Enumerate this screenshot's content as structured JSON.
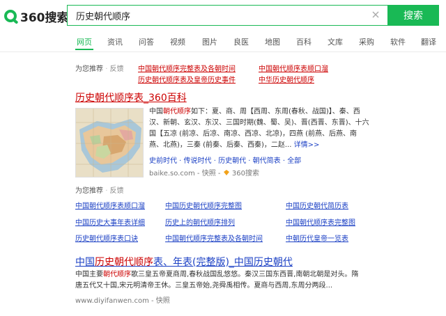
{
  "header": {
    "logo_text": "360搜索",
    "search_value": "历史朝代顺序",
    "search_button": "搜索"
  },
  "tabs": [
    "网页",
    "资讯",
    "问答",
    "视频",
    "图片",
    "良医",
    "地图",
    "百科",
    "文库",
    "采购",
    "软件",
    "翻译"
  ],
  "recommend_top": {
    "label": "为您推荐",
    "feedback": "反馈",
    "links": [
      "中国朝代顺序完整表及各朝时间",
      "中国朝代顺序表顺口溜",
      "历史朝代顺序表及皇帝历史事件",
      "中华历史朝代顺序"
    ]
  },
  "result1": {
    "title_prefix": "历史朝代顺序表",
    "title_suffix": "_360百科",
    "snippet_lines": [
      [
        "中国",
        "朝代顺序",
        "如下：夏、商、周【西周、东周(春秋、战国)】、秦、西"
      ],
      [
        "汉、新朝、玄汉、东汉、三国时期(魏、蜀、吴)、晋(西晋、东晋)、十六"
      ],
      [
        "国【五凉 (前凉、后凉、南凉、西凉、北凉)，四燕 (前燕、后燕、南"
      ],
      [
        "燕、北燕)，三秦 (前秦、后秦、西秦)，二赵...",
        "详情>>"
      ]
    ],
    "sub_links": [
      "史前时代",
      "传说时代",
      "历史朝代",
      "朝代简表",
      "全部"
    ],
    "url": "baike.so.com",
    "snapshot": "快照",
    "badge": "360搜索"
  },
  "recommend_mid": {
    "label": "为您推荐",
    "feedback": "反馈",
    "links": [
      [
        "中国朝代顺序表顺口溜",
        "中国历史朝代顺序完整图",
        "中国历史朝代简历表"
      ],
      [
        "中国历史大事年表详细",
        "历史上的朝代顺序排列",
        "中国朝代顺序表完整图"
      ],
      [
        "历史朝代顺序表口诀",
        "中国朝代顺序完整表及各朝时间",
        "中朝历代皇帝一览表"
      ]
    ]
  },
  "result2": {
    "title_a": "中国",
    "title_b": "历史朝代顺序",
    "title_c": "表、年表(完整版)_中国历史朝代",
    "snippet_line1_a": "中国主要",
    "snippet_line1_b": "朝代顺序",
    "snippet_line1_c": "歌三皇五帝夏商周,春秋战国乱悠悠。秦汉三国东西晋,南朝北朝是对头。隋",
    "snippet_line2": "唐五代又十国,宋元明清帝王休。三皇五帝始,尧舜禹相传。夏商与西周,东周分两段...",
    "url": "www.diyifanwen.com",
    "snapshot": "快照"
  },
  "colors": {
    "brand": "#19b955",
    "link_red": "#cc0000",
    "link_blue": "#1a3fc4"
  }
}
